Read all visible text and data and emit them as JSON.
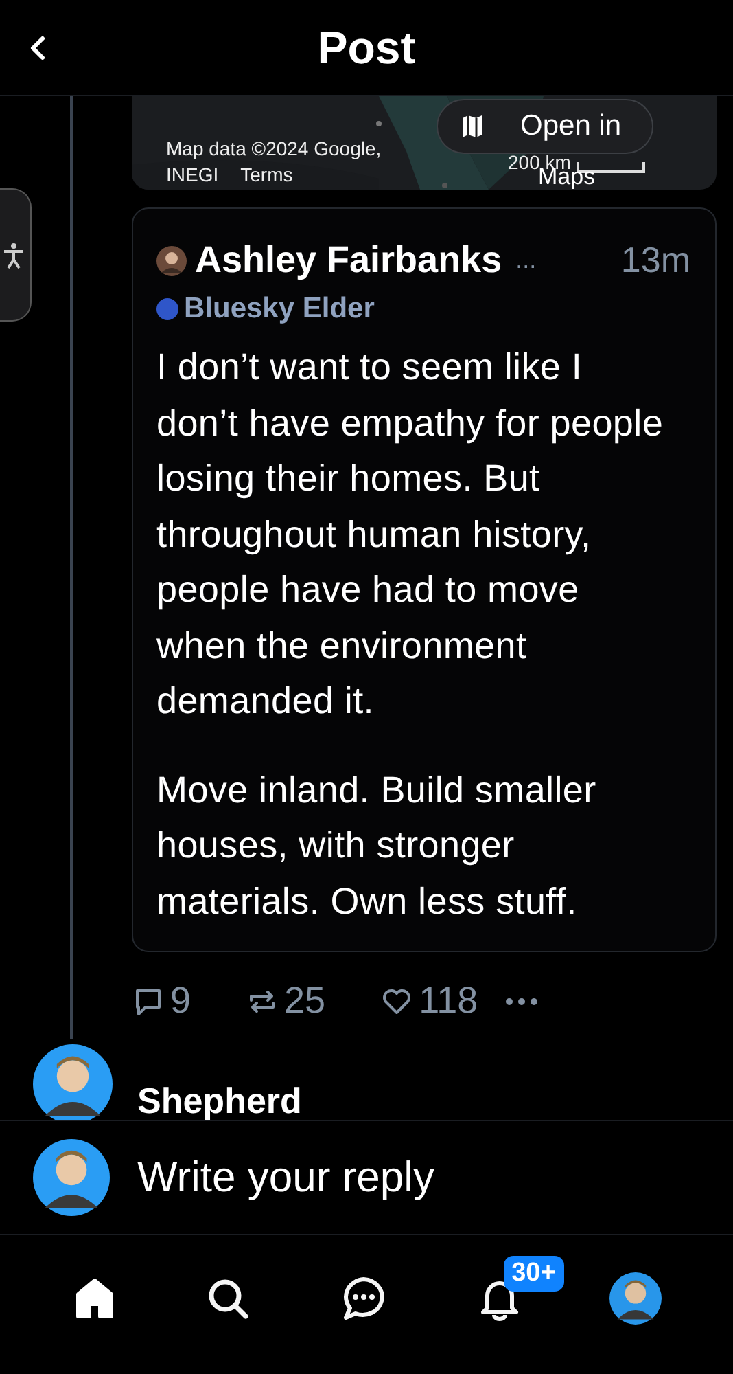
{
  "header": {
    "title": "Post"
  },
  "map": {
    "attribution": "Map data ©2024 Google,",
    "attribution_2": "INEGI",
    "terms": "Terms",
    "scale": "200 km",
    "open_button": "Open in",
    "open_button_2": "Maps"
  },
  "quote": {
    "author": "Ashley Fairbanks",
    "ellipsis": "...",
    "time": "13m",
    "label": {
      "text": "Bluesky Elder",
      "color": "#2f56c9"
    },
    "paragraphs": [
      "I don’t want to seem like I don’t have empathy for people losing their homes. But throughout human history, people have had to move when the environment demanded it.",
      "Move inland. Build smaller houses, with stronger materials. Own less stuff."
    ]
  },
  "actions": {
    "replies": "9",
    "reposts": "25",
    "likes": "118"
  },
  "next_post": {
    "author": "Shepherd"
  },
  "reply_bar": {
    "placeholder": "Write your reply"
  },
  "nav": [
    {
      "kind": "home",
      "selected": true
    },
    {
      "kind": "search",
      "selected": false
    },
    {
      "kind": "chat",
      "selected": false
    },
    {
      "kind": "notifications",
      "selected": false,
      "badge": "30+"
    },
    {
      "kind": "profile",
      "selected": false
    }
  ]
}
